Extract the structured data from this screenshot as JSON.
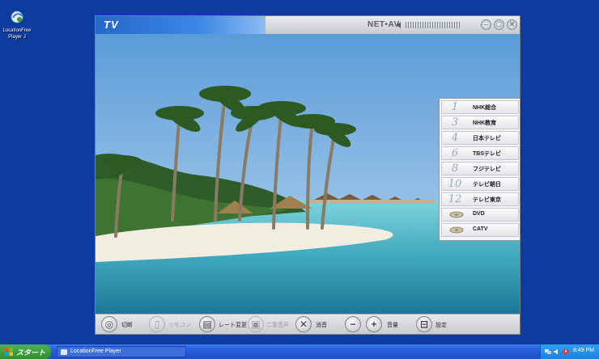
{
  "desktop": {
    "icon_label": "LocationFree\nPlayer J"
  },
  "window": {
    "mode_title": "TV",
    "brand": "NET•AV",
    "controls": [
      "minimize",
      "maximize",
      "close"
    ],
    "volume_level": 1.0
  },
  "channels": [
    {
      "number": "1",
      "name": "NHK総合"
    },
    {
      "number": "3",
      "name": "NHK教育"
    },
    {
      "number": "4",
      "name": "日本テレビ"
    },
    {
      "number": "6",
      "name": "TBSテレビ"
    },
    {
      "number": "8",
      "name": "フジテレビ"
    },
    {
      "number": "10",
      "name": "テレビ朝日"
    },
    {
      "number": "12",
      "name": "テレビ東京"
    }
  ],
  "inputs": [
    {
      "icon": "disc-icon",
      "name": "DVD"
    },
    {
      "icon": "disc-icon",
      "name": "CATV"
    }
  ],
  "toolbar": {
    "power_label": "切断",
    "remote_label": "リモコン",
    "rate_label": "レート変更",
    "dual_audio_label": "二重音声",
    "mute_label": "消音",
    "volume_label": "音量",
    "settings_label": "設定"
  },
  "taskbar": {
    "start_label": "スタート",
    "task_label": "LocationFree Player",
    "clock": "8:49 PM"
  },
  "colors": {
    "desktop": "#0d3b9e",
    "tv_tab": "#2568c8",
    "taskbar": "#245ddb",
    "start": "#2f8f2f"
  }
}
